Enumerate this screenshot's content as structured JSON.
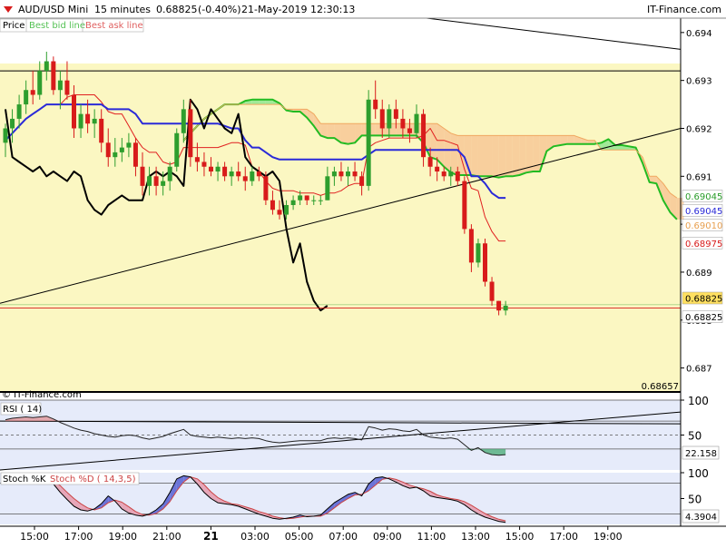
{
  "header": {
    "symbol": "AUD/USD Mini",
    "timeframe": "15 minutes",
    "last": "0.68825",
    "change": "(-0.40%)",
    "datetime": "21-May-2019 12:30:13",
    "brand": "IT-Finance.com"
  },
  "legend": {
    "price": "Price",
    "bid": "Best bid line",
    "ask": "Best ask line",
    "watermark": "© IT-Finance.com"
  },
  "colors": {
    "bull": "#2e9e2e",
    "bear": "#d81b1b",
    "tenkan": "#e02020",
    "kijun": "#2a2ad8",
    "chikou": "#000000",
    "span_a": "#22bb22",
    "span_b": "#f0a860",
    "cloud_bull": "#8fe68f",
    "cloud_bear": "#f7c896",
    "plot_bg": "#fbf7c2",
    "rsi": "#222222",
    "stoch_k": "#000000",
    "stoch_d": "#cc4444",
    "stoch_fill_bull": "#6b74d8",
    "stoch_fill_bear": "#e6a6b8"
  },
  "chart_data": [
    {
      "type": "candlestick",
      "title": "AUD/USD Mini 15 minutes",
      "ylim": [
        0.6865,
        0.6943
      ],
      "yticks": [
        "0.694",
        "0.693",
        "0.692",
        "0.691",
        "0.690",
        "0.689",
        "0.688",
        "0.687"
      ],
      "xticks": [
        "15:00",
        "17:00",
        "19:00",
        "21:00",
        "21",
        "03:00",
        "05:00",
        "07:00",
        "09:00",
        "11:00",
        "13:00",
        "15:00",
        "17:00",
        "19:00"
      ],
      "right_labels": [
        {
          "text": "0.69045",
          "color": "#2a9d2a"
        },
        {
          "text": "0.69045",
          "color": "#2a2ad8"
        },
        {
          "text": "0.69010",
          "color": "#e8a050"
        },
        {
          "text": "0.68975",
          "color": "#d81b1b"
        },
        {
          "text": "0.68825",
          "color": "#000000",
          "highlight": true
        },
        {
          "text": "0.68825",
          "color": "#000000"
        },
        {
          "text": "0.68657",
          "color": "#000000"
        }
      ],
      "candles": [
        [
          0.6917,
          0.6921,
          0.6914,
          0.692
        ],
        [
          0.692,
          0.6924,
          0.6917,
          0.6922
        ],
        [
          0.6922,
          0.6927,
          0.692,
          0.6925
        ],
        [
          0.6925,
          0.693,
          0.6923,
          0.6928
        ],
        [
          0.6928,
          0.6932,
          0.6925,
          0.6927
        ],
        [
          0.6927,
          0.6934,
          0.6926,
          0.6932
        ],
        [
          0.6932,
          0.6936,
          0.693,
          0.6934
        ],
        [
          0.6934,
          0.6935,
          0.6927,
          0.6928
        ],
        [
          0.6928,
          0.6932,
          0.6924,
          0.693
        ],
        [
          0.693,
          0.6934,
          0.6926,
          0.6927
        ],
        [
          0.6927,
          0.6929,
          0.6918,
          0.692
        ],
        [
          0.692,
          0.6925,
          0.6918,
          0.6923
        ],
        [
          0.6923,
          0.6926,
          0.6919,
          0.6921
        ],
        [
          0.6921,
          0.6924,
          0.6918,
          0.6922
        ],
        [
          0.6922,
          0.6924,
          0.6915,
          0.6917
        ],
        [
          0.6917,
          0.692,
          0.6912,
          0.6914
        ],
        [
          0.6914,
          0.6918,
          0.6912,
          0.6915
        ],
        [
          0.6915,
          0.6918,
          0.6913,
          0.6916
        ],
        [
          0.6916,
          0.6919,
          0.6914,
          0.6917
        ],
        [
          0.6917,
          0.6918,
          0.691,
          0.6912
        ],
        [
          0.6912,
          0.6915,
          0.6906,
          0.6908
        ],
        [
          0.6908,
          0.6912,
          0.6906,
          0.691
        ],
        [
          0.691,
          0.6912,
          0.6906,
          0.6908
        ],
        [
          0.6908,
          0.6911,
          0.6906,
          0.6909
        ],
        [
          0.6909,
          0.6913,
          0.6907,
          0.6912
        ],
        [
          0.6912,
          0.692,
          0.6911,
          0.6919
        ],
        [
          0.6919,
          0.6926,
          0.6917,
          0.6924
        ],
        [
          0.6924,
          0.6926,
          0.6912,
          0.6914
        ],
        [
          0.6914,
          0.6917,
          0.6911,
          0.6913
        ],
        [
          0.6913,
          0.6915,
          0.691,
          0.6912
        ],
        [
          0.6912,
          0.6914,
          0.691,
          0.6911
        ],
        [
          0.6911,
          0.6913,
          0.6909,
          0.6912
        ],
        [
          0.6912,
          0.6913,
          0.6909,
          0.691
        ],
        [
          0.691,
          0.6912,
          0.6908,
          0.6911
        ],
        [
          0.6911,
          0.6913,
          0.6909,
          0.691
        ],
        [
          0.691,
          0.6912,
          0.6907,
          0.6909
        ],
        [
          0.6909,
          0.6912,
          0.6908,
          0.6911
        ],
        [
          0.6911,
          0.6912,
          0.6909,
          0.691
        ],
        [
          0.691,
          0.6911,
          0.6904,
          0.6905
        ],
        [
          0.6905,
          0.6907,
          0.6902,
          0.6903
        ],
        [
          0.6903,
          0.6905,
          0.6901,
          0.6902
        ],
        [
          0.6902,
          0.6905,
          0.6901,
          0.6904
        ],
        [
          0.6904,
          0.6906,
          0.6903,
          0.6905
        ],
        [
          0.6905,
          0.6907,
          0.6904,
          0.6906
        ],
        [
          0.6906,
          0.6906,
          0.6904,
          0.6905
        ],
        [
          0.6905,
          0.6906,
          0.6904,
          0.6905
        ],
        [
          0.6905,
          0.6906,
          0.6904,
          0.6905
        ],
        [
          0.6905,
          0.6912,
          0.6905,
          0.691
        ],
        [
          0.691,
          0.6912,
          0.6908,
          0.6911
        ],
        [
          0.6911,
          0.6913,
          0.6909,
          0.691
        ],
        [
          0.691,
          0.6912,
          0.6908,
          0.6911
        ],
        [
          0.6911,
          0.6913,
          0.6909,
          0.691
        ],
        [
          0.691,
          0.6911,
          0.6906,
          0.6908
        ],
        [
          0.6908,
          0.6928,
          0.6907,
          0.6926
        ],
        [
          0.6926,
          0.693,
          0.6922,
          0.6924
        ],
        [
          0.6924,
          0.6926,
          0.6918,
          0.692
        ],
        [
          0.692,
          0.6925,
          0.6918,
          0.6924
        ],
        [
          0.6924,
          0.6926,
          0.692,
          0.6922
        ],
        [
          0.6922,
          0.6924,
          0.6918,
          0.692
        ],
        [
          0.692,
          0.6922,
          0.6917,
          0.6919
        ],
        [
          0.6919,
          0.6925,
          0.6918,
          0.6923
        ],
        [
          0.6923,
          0.6924,
          0.6912,
          0.6914
        ],
        [
          0.6914,
          0.6916,
          0.691,
          0.6912
        ],
        [
          0.6912,
          0.6914,
          0.6909,
          0.6911
        ],
        [
          0.6911,
          0.6912,
          0.6909,
          0.691
        ],
        [
          0.691,
          0.6912,
          0.6908,
          0.6911
        ],
        [
          0.6911,
          0.6912,
          0.6908,
          0.6909
        ],
        [
          0.6909,
          0.691,
          0.6898,
          0.6899
        ],
        [
          0.6899,
          0.69,
          0.689,
          0.6892
        ],
        [
          0.6892,
          0.6897,
          0.6891,
          0.6896
        ],
        [
          0.6896,
          0.6897,
          0.6887,
          0.6888
        ],
        [
          0.6888,
          0.6889,
          0.6883,
          0.6884
        ],
        [
          0.6884,
          0.6884,
          0.6881,
          0.6882
        ],
        [
          0.6882,
          0.6884,
          0.6881,
          0.6883
        ]
      ]
    },
    {
      "type": "line",
      "title": "RSI ( 14)",
      "ylim": [
        0,
        100
      ],
      "yticks": [
        "100",
        "50"
      ],
      "last_label": "22.158",
      "levels": [
        70,
        30
      ],
      "values": [
        72,
        74,
        75,
        76,
        75,
        76,
        77,
        73,
        68,
        64,
        60,
        57,
        55,
        52,
        50,
        48,
        47,
        49,
        50,
        49,
        46,
        44,
        46,
        48,
        52,
        55,
        58,
        50,
        48,
        47,
        46,
        47,
        46,
        45,
        46,
        45,
        46,
        45,
        42,
        40,
        39,
        40,
        41,
        42,
        42,
        42,
        42,
        45,
        46,
        45,
        46,
        45,
        43,
        62,
        60,
        57,
        59,
        58,
        56,
        55,
        58,
        50,
        47,
        46,
        45,
        46,
        44,
        36,
        28,
        32,
        25,
        22,
        21,
        22
      ]
    },
    {
      "type": "line",
      "title": "Stoch %K",
      "subtitle": "Stoch %D ( 14,3,5)",
      "ylim": [
        0,
        100
      ],
      "yticks": [
        "100",
        "50"
      ],
      "last_label": "4.3904",
      "levels": [
        80,
        20
      ],
      "k": [
        85,
        88,
        92,
        95,
        90,
        93,
        90,
        78,
        62,
        48,
        35,
        28,
        26,
        30,
        40,
        55,
        45,
        30,
        22,
        18,
        16,
        20,
        28,
        40,
        62,
        88,
        94,
        92,
        78,
        62,
        50,
        42,
        40,
        38,
        35,
        30,
        25,
        20,
        16,
        12,
        10,
        12,
        14,
        18,
        15,
        16,
        18,
        30,
        42,
        50,
        58,
        62,
        55,
        78,
        90,
        92,
        88,
        82,
        75,
        70,
        72,
        65,
        55,
        52,
        50,
        48,
        45,
        38,
        28,
        20,
        14,
        10,
        6,
        4
      ],
      "d": [
        78,
        82,
        86,
        90,
        91,
        91,
        90,
        85,
        75,
        62,
        50,
        40,
        32,
        28,
        32,
        42,
        47,
        43,
        34,
        25,
        19,
        18,
        21,
        30,
        44,
        65,
        82,
        92,
        88,
        77,
        63,
        52,
        45,
        40,
        38,
        34,
        30,
        25,
        21,
        16,
        13,
        11,
        12,
        14,
        16,
        16,
        16,
        22,
        32,
        42,
        50,
        57,
        58,
        65,
        76,
        87,
        90,
        87,
        82,
        76,
        72,
        69,
        64,
        57,
        53,
        50,
        48,
        44,
        37,
        29,
        21,
        15,
        10,
        7
      ]
    }
  ]
}
